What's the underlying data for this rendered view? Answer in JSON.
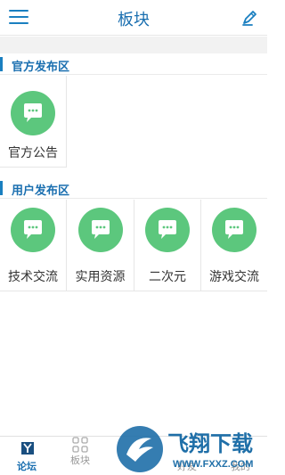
{
  "header": {
    "title": "板块"
  },
  "sections": [
    {
      "label": "官方发布区",
      "boards": [
        {
          "name": "官方公告"
        }
      ]
    },
    {
      "label": "用户发布区",
      "boards": [
        {
          "name": "技术交流"
        },
        {
          "name": "实用资源"
        },
        {
          "name": "二次元"
        },
        {
          "name": "游戏交流"
        }
      ]
    }
  ],
  "tabbar": {
    "items": [
      {
        "label": "论坛",
        "icon": "forum-icon",
        "active": true
      },
      {
        "label": "板块",
        "icon": "grid-icon",
        "active": false
      },
      {
        "label": "好友",
        "icon": "friends-icon",
        "active": false
      },
      {
        "label": "我的",
        "icon": "profile-icon",
        "active": false
      }
    ]
  },
  "watermark": {
    "brand": "飞翔下载",
    "site": "WWW.FXXZ.COM"
  },
  "colors": {
    "accent": "#1a6fb0",
    "bubble": "#5cc77d"
  }
}
